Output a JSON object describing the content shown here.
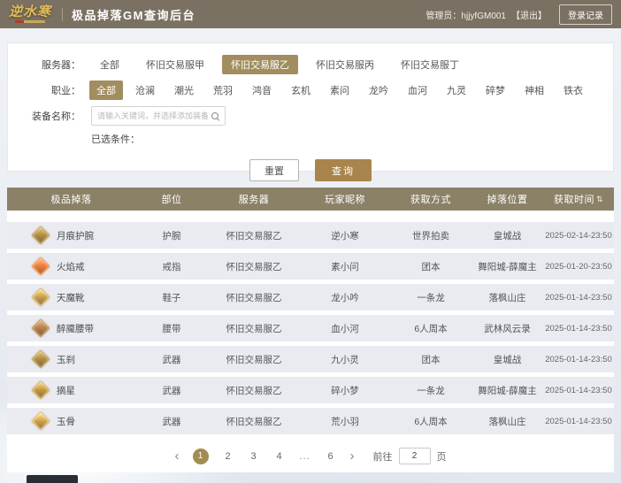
{
  "header": {
    "logo_title": "逆水寒",
    "app_title": "极品掉落GM查询后台",
    "admin_label": "管理员：hjjyfGM001",
    "logout_label": "【退出】",
    "login_log_button": "登录记录"
  },
  "filters": {
    "server": {
      "label": "服务器：",
      "options": [
        "全部",
        "怀旧交易服甲",
        "怀旧交易服乙",
        "怀旧交易服丙",
        "怀旧交易服丁"
      ],
      "selected": "怀旧交易服乙"
    },
    "profession": {
      "label": "职业：",
      "options": [
        "全部",
        "沧澜",
        "潮光",
        "荒羽",
        "鸿音",
        "玄机",
        "素问",
        "龙吟",
        "血河",
        "九灵",
        "碎梦",
        "神相",
        "铁衣"
      ],
      "selected": "全部"
    },
    "equip_name": {
      "label": "装备名称：",
      "placeholder": "请输入关键词，并选择添加装备的条件",
      "value": ""
    },
    "selected_conditions_label": "已选条件：",
    "reset_button": "重置",
    "search_button": "查询"
  },
  "table": {
    "columns": [
      "极品掉落",
      "部位",
      "服务器",
      "玩家昵称",
      "获取方式",
      "掉落位置",
      "获取时间"
    ],
    "sort_column": "获取时间",
    "rows": [
      {
        "item": "月痕护腕",
        "slot": "护腕",
        "server": "怀旧交易服乙",
        "player": "逆小寒",
        "method": "世界拍卖",
        "location": "皇城战",
        "time": "2025-02-14-23:50"
      },
      {
        "item": "火焰戒",
        "slot": "戒指",
        "server": "怀旧交易服乙",
        "player": "素小问",
        "method": "团本",
        "location": "舞阳城-薛魔主",
        "time": "2025-01-20-23:50"
      },
      {
        "item": "天魔靴",
        "slot": "鞋子",
        "server": "怀旧交易服乙",
        "player": "龙小吟",
        "method": "一条龙",
        "location": "落枫山庄",
        "time": "2025-01-14-23:50"
      },
      {
        "item": "醉魇腰带",
        "slot": "腰带",
        "server": "怀旧交易服乙",
        "player": "血小河",
        "method": "6人周本",
        "location": "武林风云录",
        "time": "2025-01-14-23:50"
      },
      {
        "item": "玉刹",
        "slot": "武器",
        "server": "怀旧交易服乙",
        "player": "九小灵",
        "method": "团本",
        "location": "皇城战",
        "time": "2025-01-14-23:50"
      },
      {
        "item": "摘星",
        "slot": "武器",
        "server": "怀旧交易服乙",
        "player": "碎小梦",
        "method": "一条龙",
        "location": "舞阳城-薛魔主",
        "time": "2025-01-14-23:50"
      },
      {
        "item": "玉骨",
        "slot": "武器",
        "server": "怀旧交易服乙",
        "player": "荒小羽",
        "method": "6人周本",
        "location": "落枫山庄",
        "time": "2025-01-14-23:50"
      }
    ]
  },
  "pagination": {
    "pages": [
      "1",
      "2",
      "3",
      "4",
      "...",
      "6"
    ],
    "current": "1",
    "goto_label": "前往",
    "goto_value": "2",
    "page_unit": "页"
  },
  "icons": {
    "sort": "⇅",
    "prev": "‹",
    "next": "›"
  },
  "colors": {
    "topbar_bg": "#7a7162",
    "accent_gold": "#a9854d",
    "selected_chip": "#a28d5f",
    "table_header_bg": "#8b8166",
    "row_bg": "#e9ebf0",
    "active_page": "#a28c52",
    "logo_gold": "#e3bc55"
  }
}
